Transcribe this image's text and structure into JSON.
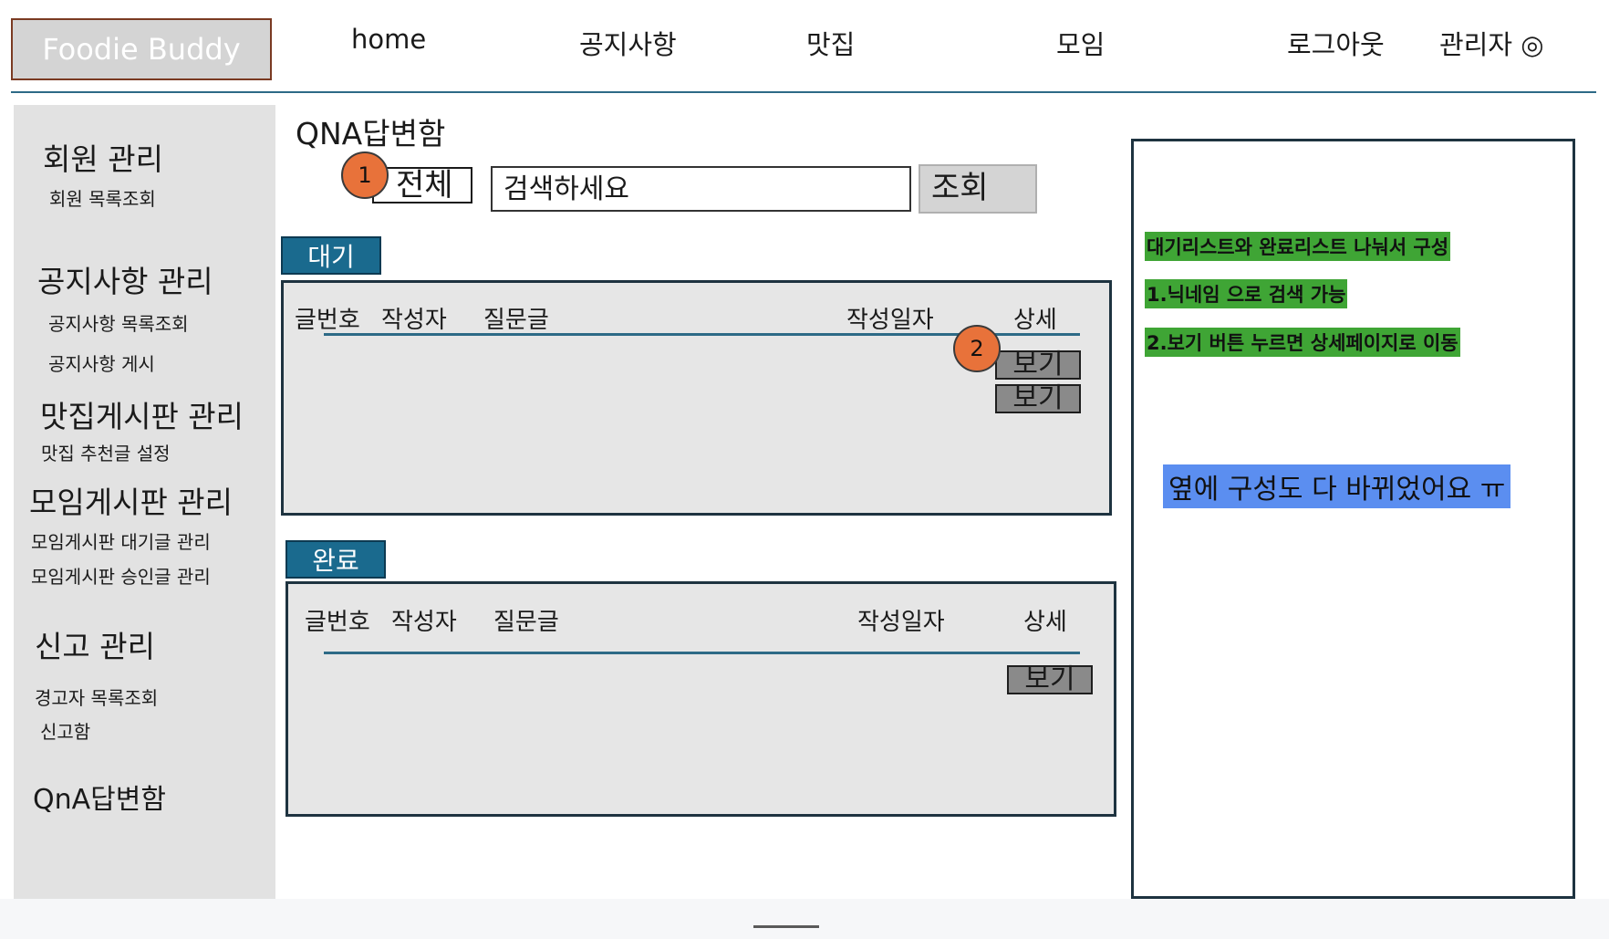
{
  "header": {
    "logo": "Foodie Buddy",
    "nav": [
      "home",
      "공지사항",
      "맛집",
      "모임",
      "로그아웃",
      "관리자 ◎"
    ]
  },
  "sidebar": {
    "sections": [
      {
        "title": "회원 관리",
        "items": [
          "회원 목록조회"
        ]
      },
      {
        "title": "공지사항 관리",
        "items": [
          "공지사항 목록조회",
          "공지사항 게시"
        ]
      },
      {
        "title": "맛집게시판 관리",
        "items": [
          "맛집 추천글 설정"
        ]
      },
      {
        "title": "모임게시판 관리",
        "items": [
          "모임게시판 대기글 관리",
          "모임게시판 승인글 관리"
        ]
      },
      {
        "title": "신고 관리",
        "items": [
          "경고자 목록조회",
          "신고함"
        ]
      },
      {
        "title": "QnA답변함",
        "items": []
      }
    ]
  },
  "main": {
    "title": "QNA답변함",
    "filter_value": "전체",
    "search_placeholder": "검색하세요",
    "search_button": "조회",
    "badges": [
      "1",
      "2"
    ],
    "pending": {
      "tab": "대기",
      "columns": [
        "글번호",
        "작성자",
        "질문글",
        "작성일자",
        "상세"
      ],
      "rows": [
        {
          "action": "보기"
        },
        {
          "action": "보기"
        }
      ]
    },
    "done": {
      "tab": "완료",
      "columns": [
        "글번호",
        "작성자",
        "질문글",
        "작성일자",
        "상세"
      ],
      "rows": [
        {
          "action": "보기"
        }
      ]
    }
  },
  "notes": {
    "green": [
      "대기리스트와 완료리스트 나눠서 구성",
      "1.닉네임 으로 검색 가능",
      "2.보기 버튼 누르면 상세페이지로 이동"
    ],
    "blue": "옆에 구성도 다 바뀌었어요 ㅠ"
  },
  "colors": {
    "accent": "#1a6a8e",
    "badge": "#e8723a",
    "note_green": "#3fa535",
    "note_blue": "#5b8ef0",
    "logo_border": "#7a3a22"
  }
}
